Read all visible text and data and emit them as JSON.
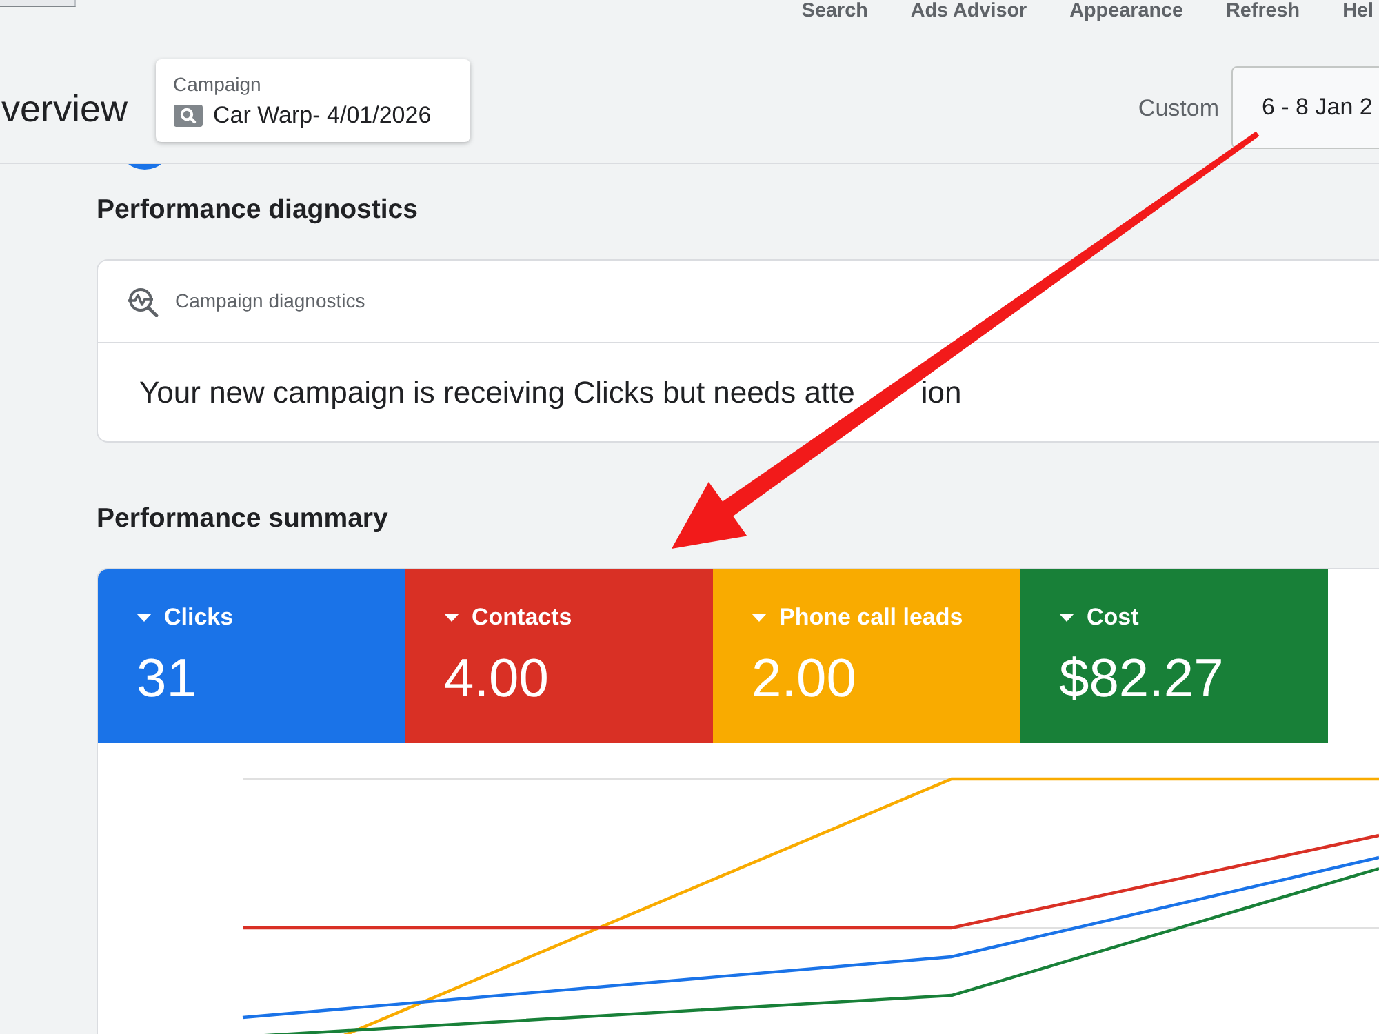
{
  "toolbar": {
    "links": [
      "Search",
      "Ads Advisor",
      "Appearance",
      "Refresh",
      "Hel"
    ]
  },
  "header": {
    "title": "verview",
    "campaign_selector": {
      "label": "Campaign",
      "value": "Car Warp- 4/01/2026"
    },
    "date_range": {
      "label": "Custom",
      "value": "6 - 8 Jan 2"
    }
  },
  "diagnostics": {
    "heading": "Performance diagnostics",
    "card_title": "Campaign diagnostics",
    "message_parts": [
      "Your new campaign is receiving Clicks but needs atte",
      "ion"
    ]
  },
  "summary": {
    "heading": "Performance summary",
    "metrics": [
      {
        "label": "Clicks",
        "value": "31",
        "color": "#1a73e8",
        "selected": true
      },
      {
        "label": "Contacts",
        "value": "4.00",
        "color": "#d93025",
        "selected": true
      },
      {
        "label": "Phone call leads",
        "value": "2.00",
        "color": "#f9ab00",
        "selected": true
      },
      {
        "label": "Cost",
        "value": "$82.27",
        "color": "#188038",
        "selected": true
      }
    ]
  }
}
